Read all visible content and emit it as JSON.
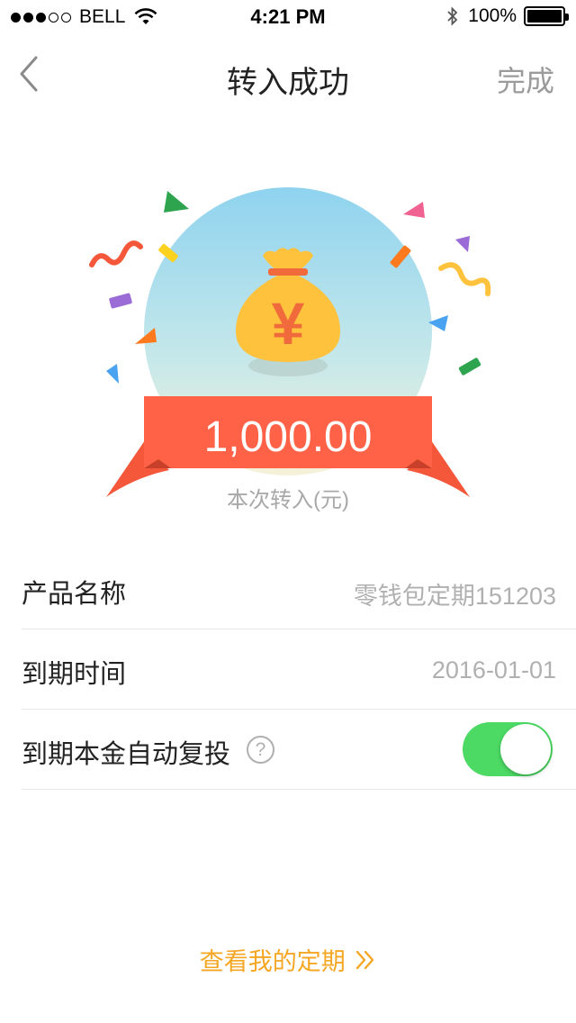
{
  "status_bar": {
    "carrier": "BELL",
    "signal_full_dots": 3,
    "signal_empty_dots": 2,
    "time": "4:21 PM",
    "battery": "100%",
    "battery_level": 1.0
  },
  "nav": {
    "title": "转入成功",
    "done_label": "完成"
  },
  "hero": {
    "amount": "1,000.00",
    "amount_label": "本次转入(元)",
    "bag_symbol": "¥"
  },
  "rows": [
    {
      "label": "产品名称",
      "value": "零钱包定期151203"
    },
    {
      "label": "到期时间",
      "value": "2016-01-01"
    },
    {
      "label": "到期本金自动复投",
      "help": "?",
      "toggle_on": true
    }
  ],
  "bottom_link": {
    "label": "查看我的定期",
    "icon": "double-chevron-right-icon"
  },
  "colors": {
    "accent_orange": "#f5a623",
    "ribbon": "#ff6247",
    "toggle_on": "#4cd964",
    "muted_text": "#b0b0b0"
  }
}
